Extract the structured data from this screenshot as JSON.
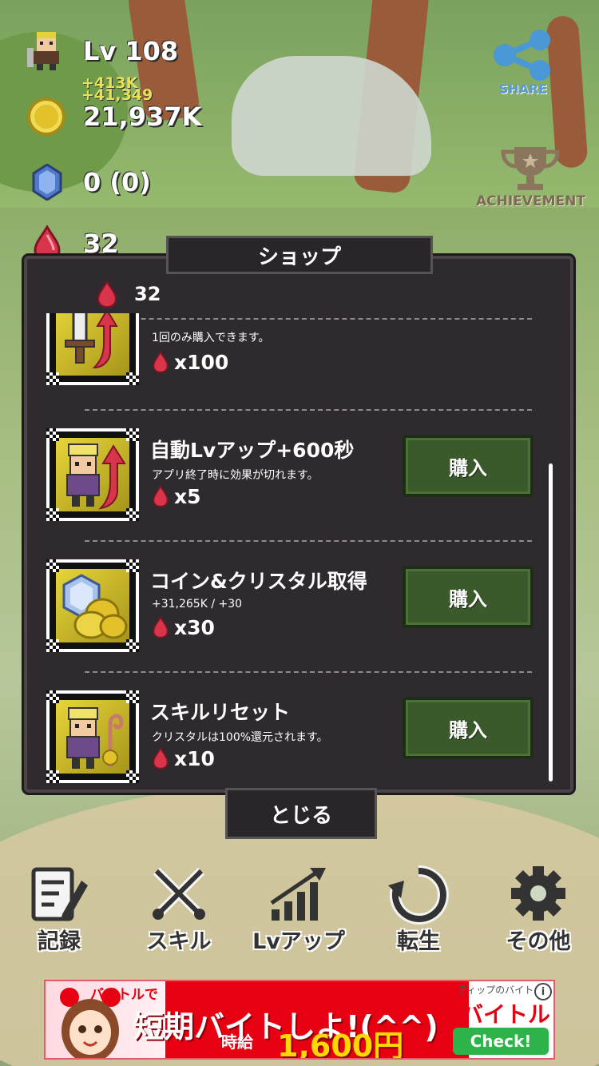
{
  "hud": {
    "level": "Lv 108",
    "gain_top": "+413K",
    "gain_bottom": "+41,349",
    "coins": "21,937K",
    "crystals": "0 (0)",
    "gems": "32"
  },
  "side_buttons": {
    "share_label": "SHARE",
    "achievement_label": "ACHIEVEMENT"
  },
  "shop": {
    "title": "ショップ",
    "gem_balance": "32",
    "items": [
      {
        "name": "",
        "desc": "1回のみ購入できます。",
        "price": "x100",
        "icon": "sword-attack-icon",
        "buy_label": ""
      },
      {
        "name": "自動Lvアップ+600秒",
        "desc": "アプリ終了時に効果が切れます。",
        "price": "x5",
        "icon": "hero-levelup-icon",
        "buy_label": "購入"
      },
      {
        "name": "コイン&クリスタル取得",
        "desc": "+31,265K / +30",
        "price": "x30",
        "icon": "coins-crystal-icon",
        "buy_label": "購入"
      },
      {
        "name": "スキルリセット",
        "desc": "クリスタルは100%還元されます。",
        "price": "x10",
        "icon": "skill-reset-icon",
        "buy_label": "購入"
      }
    ],
    "close_label": "とじる"
  },
  "nav": [
    {
      "label": "記録",
      "icon": "record-icon"
    },
    {
      "label": "スキル",
      "icon": "crossed-swords-icon"
    },
    {
      "label": "Lvアップ",
      "icon": "levelup-chart-icon"
    },
    {
      "label": "転生",
      "icon": "rebirth-icon"
    },
    {
      "label": "その他",
      "icon": "gear-icon"
    }
  ],
  "ad": {
    "top_left": "バイトルで",
    "top_right": "ディップのバイト",
    "main": "短期バイトしよ!(^^)",
    "wage_label": "時給",
    "wage_amount": "1,600円",
    "brand": "バイトル",
    "cta": "Check!",
    "info": "i"
  },
  "colors": {
    "dialog_bg": "#2f2a2e",
    "buy_button": "#3b5a2b",
    "gem_red": "#d8354a",
    "coin_gold": "#e2c12a",
    "share_blue": "#4a98d6"
  }
}
